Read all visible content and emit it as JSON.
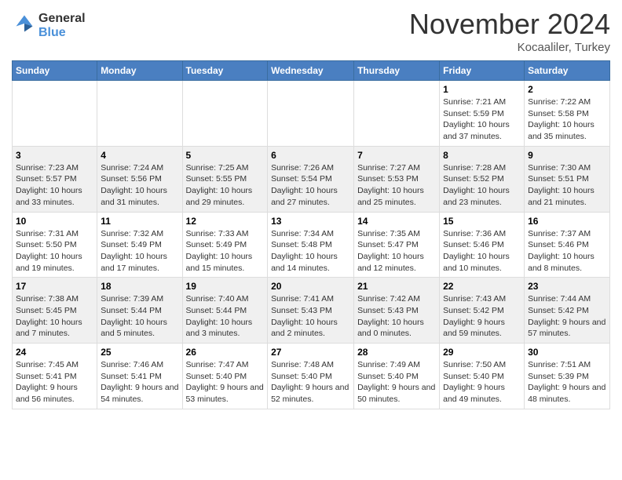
{
  "header": {
    "logo_line1": "General",
    "logo_line2": "Blue",
    "month": "November 2024",
    "location": "Kocaaliler, Turkey"
  },
  "weekdays": [
    "Sunday",
    "Monday",
    "Tuesday",
    "Wednesday",
    "Thursday",
    "Friday",
    "Saturday"
  ],
  "weeks": [
    [
      {
        "day": "",
        "info": ""
      },
      {
        "day": "",
        "info": ""
      },
      {
        "day": "",
        "info": ""
      },
      {
        "day": "",
        "info": ""
      },
      {
        "day": "",
        "info": ""
      },
      {
        "day": "1",
        "info": "Sunrise: 7:21 AM\nSunset: 5:59 PM\nDaylight: 10 hours and 37 minutes."
      },
      {
        "day": "2",
        "info": "Sunrise: 7:22 AM\nSunset: 5:58 PM\nDaylight: 10 hours and 35 minutes."
      }
    ],
    [
      {
        "day": "3",
        "info": "Sunrise: 7:23 AM\nSunset: 5:57 PM\nDaylight: 10 hours and 33 minutes."
      },
      {
        "day": "4",
        "info": "Sunrise: 7:24 AM\nSunset: 5:56 PM\nDaylight: 10 hours and 31 minutes."
      },
      {
        "day": "5",
        "info": "Sunrise: 7:25 AM\nSunset: 5:55 PM\nDaylight: 10 hours and 29 minutes."
      },
      {
        "day": "6",
        "info": "Sunrise: 7:26 AM\nSunset: 5:54 PM\nDaylight: 10 hours and 27 minutes."
      },
      {
        "day": "7",
        "info": "Sunrise: 7:27 AM\nSunset: 5:53 PM\nDaylight: 10 hours and 25 minutes."
      },
      {
        "day": "8",
        "info": "Sunrise: 7:28 AM\nSunset: 5:52 PM\nDaylight: 10 hours and 23 minutes."
      },
      {
        "day": "9",
        "info": "Sunrise: 7:30 AM\nSunset: 5:51 PM\nDaylight: 10 hours and 21 minutes."
      }
    ],
    [
      {
        "day": "10",
        "info": "Sunrise: 7:31 AM\nSunset: 5:50 PM\nDaylight: 10 hours and 19 minutes."
      },
      {
        "day": "11",
        "info": "Sunrise: 7:32 AM\nSunset: 5:49 PM\nDaylight: 10 hours and 17 minutes."
      },
      {
        "day": "12",
        "info": "Sunrise: 7:33 AM\nSunset: 5:49 PM\nDaylight: 10 hours and 15 minutes."
      },
      {
        "day": "13",
        "info": "Sunrise: 7:34 AM\nSunset: 5:48 PM\nDaylight: 10 hours and 14 minutes."
      },
      {
        "day": "14",
        "info": "Sunrise: 7:35 AM\nSunset: 5:47 PM\nDaylight: 10 hours and 12 minutes."
      },
      {
        "day": "15",
        "info": "Sunrise: 7:36 AM\nSunset: 5:46 PM\nDaylight: 10 hours and 10 minutes."
      },
      {
        "day": "16",
        "info": "Sunrise: 7:37 AM\nSunset: 5:46 PM\nDaylight: 10 hours and 8 minutes."
      }
    ],
    [
      {
        "day": "17",
        "info": "Sunrise: 7:38 AM\nSunset: 5:45 PM\nDaylight: 10 hours and 7 minutes."
      },
      {
        "day": "18",
        "info": "Sunrise: 7:39 AM\nSunset: 5:44 PM\nDaylight: 10 hours and 5 minutes."
      },
      {
        "day": "19",
        "info": "Sunrise: 7:40 AM\nSunset: 5:44 PM\nDaylight: 10 hours and 3 minutes."
      },
      {
        "day": "20",
        "info": "Sunrise: 7:41 AM\nSunset: 5:43 PM\nDaylight: 10 hours and 2 minutes."
      },
      {
        "day": "21",
        "info": "Sunrise: 7:42 AM\nSunset: 5:43 PM\nDaylight: 10 hours and 0 minutes."
      },
      {
        "day": "22",
        "info": "Sunrise: 7:43 AM\nSunset: 5:42 PM\nDaylight: 9 hours and 59 minutes."
      },
      {
        "day": "23",
        "info": "Sunrise: 7:44 AM\nSunset: 5:42 PM\nDaylight: 9 hours and 57 minutes."
      }
    ],
    [
      {
        "day": "24",
        "info": "Sunrise: 7:45 AM\nSunset: 5:41 PM\nDaylight: 9 hours and 56 minutes."
      },
      {
        "day": "25",
        "info": "Sunrise: 7:46 AM\nSunset: 5:41 PM\nDaylight: 9 hours and 54 minutes."
      },
      {
        "day": "26",
        "info": "Sunrise: 7:47 AM\nSunset: 5:40 PM\nDaylight: 9 hours and 53 minutes."
      },
      {
        "day": "27",
        "info": "Sunrise: 7:48 AM\nSunset: 5:40 PM\nDaylight: 9 hours and 52 minutes."
      },
      {
        "day": "28",
        "info": "Sunrise: 7:49 AM\nSunset: 5:40 PM\nDaylight: 9 hours and 50 minutes."
      },
      {
        "day": "29",
        "info": "Sunrise: 7:50 AM\nSunset: 5:40 PM\nDaylight: 9 hours and 49 minutes."
      },
      {
        "day": "30",
        "info": "Sunrise: 7:51 AM\nSunset: 5:39 PM\nDaylight: 9 hours and 48 minutes."
      }
    ]
  ]
}
